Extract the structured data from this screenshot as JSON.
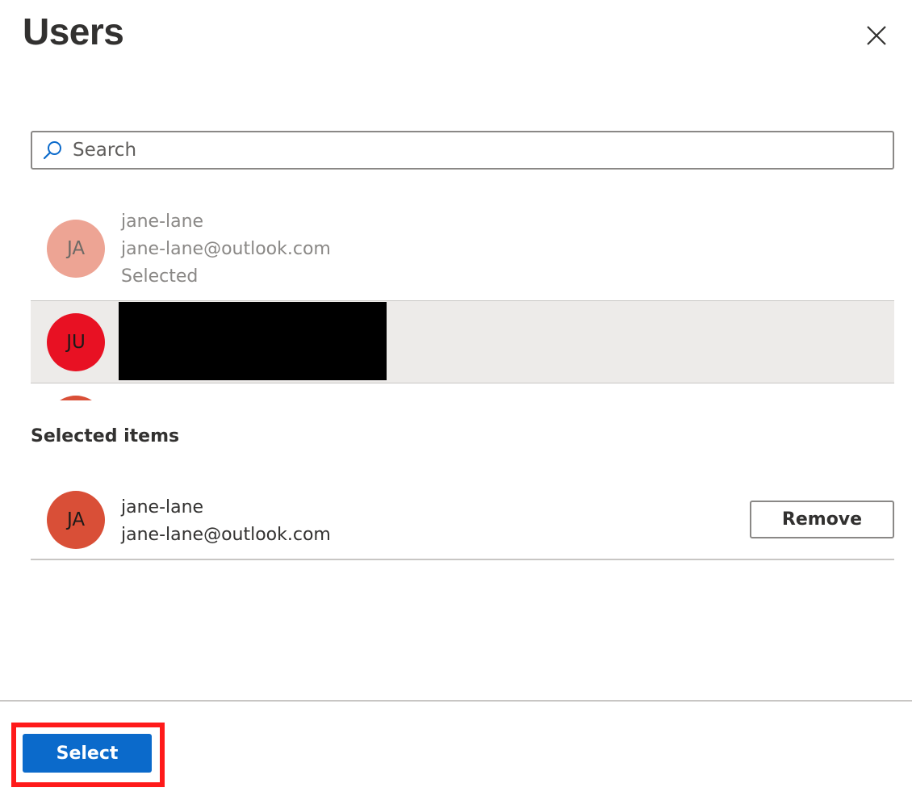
{
  "header": {
    "title": "Users",
    "close_icon": "close-icon"
  },
  "search": {
    "placeholder": "Search",
    "value": "",
    "icon": "search-icon"
  },
  "results": [
    {
      "initials": "JA",
      "name": "jane-lane",
      "email": "jane-lane@outlook.com",
      "status": "Selected",
      "avatar_color": "#eda494"
    },
    {
      "initials": "JU",
      "redacted": true,
      "avatar_color": "#e81123"
    },
    {
      "avatar_color": "#d94f37"
    }
  ],
  "selected_items": {
    "heading": "Selected items",
    "items": [
      {
        "initials": "JA",
        "name": "jane-lane",
        "email": "jane-lane@outlook.com",
        "remove_label": "Remove",
        "avatar_color": "#d94f37"
      }
    ]
  },
  "footer": {
    "select_label": "Select",
    "accent_color": "#0b6acb",
    "highlight_color": "#ff1a1a"
  }
}
